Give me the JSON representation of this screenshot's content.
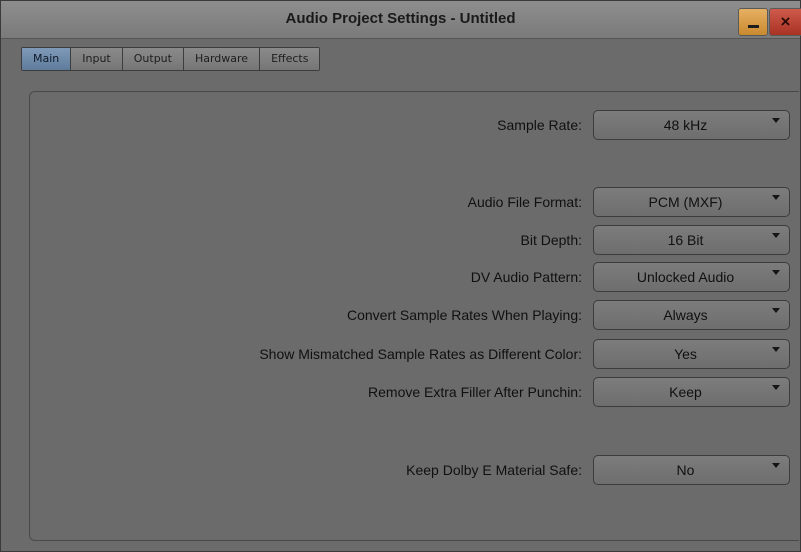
{
  "window": {
    "title": "Audio Project Settings - Untitled",
    "close_glyph": "×"
  },
  "tabs": [
    {
      "label": "Main",
      "active": true
    },
    {
      "label": "Input",
      "active": false
    },
    {
      "label": "Output",
      "active": false
    },
    {
      "label": "Hardware",
      "active": false
    },
    {
      "label": "Effects",
      "active": false
    }
  ],
  "settings": [
    {
      "label": "Sample Rate:",
      "value": "48 kHz"
    },
    {
      "label": "Audio File Format:",
      "value": "PCM  (MXF)"
    },
    {
      "label": "Bit Depth:",
      "value": "16 Bit"
    },
    {
      "label": "DV Audio Pattern:",
      "value": "Unlocked Audio"
    },
    {
      "label": "Convert Sample Rates When Playing:",
      "value": "Always"
    },
    {
      "label": "Show Mismatched Sample Rates as Different Color:",
      "value": "Yes"
    },
    {
      "label": "Remove Extra Filler After Punchin:",
      "value": "Keep"
    },
    {
      "label": "Keep Dolby E Material Safe:",
      "value": "No"
    }
  ],
  "colors": {
    "active_tab": "#6f8bab",
    "minimize_button": "#d99e48",
    "close_button": "#bd4636"
  }
}
